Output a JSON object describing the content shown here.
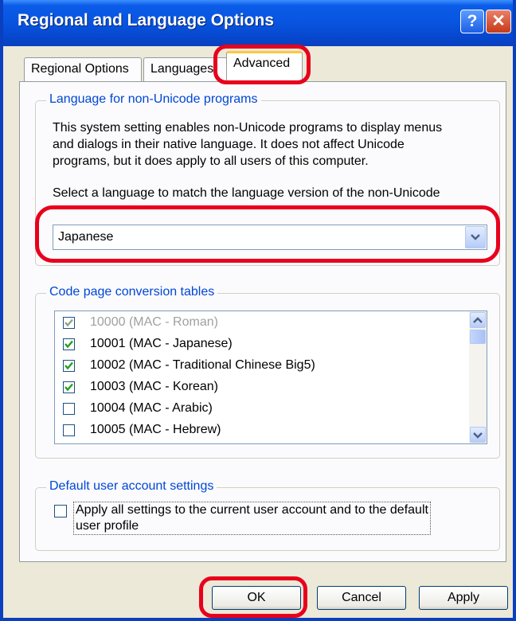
{
  "window": {
    "title": "Regional and Language Options",
    "help_glyph": "?",
    "close_glyph": "✕"
  },
  "tabs": [
    {
      "label": "Regional Options",
      "active": false
    },
    {
      "label": "Languages",
      "active": false
    },
    {
      "label": "Advanced",
      "active": true
    }
  ],
  "non_unicode": {
    "group_label": "Language for non-Unicode programs",
    "description": [
      "This system setting enables non-Unicode programs to display menus",
      "and dialogs in their native language. It does not affect Unicode",
      "programs, but it does apply to all users of this computer."
    ],
    "select_prompt": "Select a language to match the language version of the non-Unicode",
    "selected_language": "Japanese"
  },
  "code_pages": {
    "group_label": "Code page conversion tables",
    "items": [
      {
        "label": "10000 (MAC - Roman)",
        "checked": true,
        "disabled": true
      },
      {
        "label": "10001 (MAC - Japanese)",
        "checked": true,
        "disabled": false
      },
      {
        "label": "10002 (MAC - Traditional Chinese Big5)",
        "checked": true,
        "disabled": false
      },
      {
        "label": "10003 (MAC - Korean)",
        "checked": true,
        "disabled": false
      },
      {
        "label": "10004 (MAC - Arabic)",
        "checked": false,
        "disabled": false
      },
      {
        "label": "10005 (MAC - Hebrew)",
        "checked": false,
        "disabled": false
      }
    ]
  },
  "default_user": {
    "group_label": "Default user account settings",
    "checkbox_label_line1": "Apply all settings to the current user account and to the default",
    "checkbox_label_line2": "user profile",
    "checked": false
  },
  "buttons": {
    "ok": "OK",
    "cancel": "Cancel",
    "apply": "Apply"
  },
  "colors": {
    "title_bar": "#0854e0",
    "group_label": "#0046d5",
    "highlight": "#e8001c",
    "active_tab_accent": "#ffc73c"
  }
}
